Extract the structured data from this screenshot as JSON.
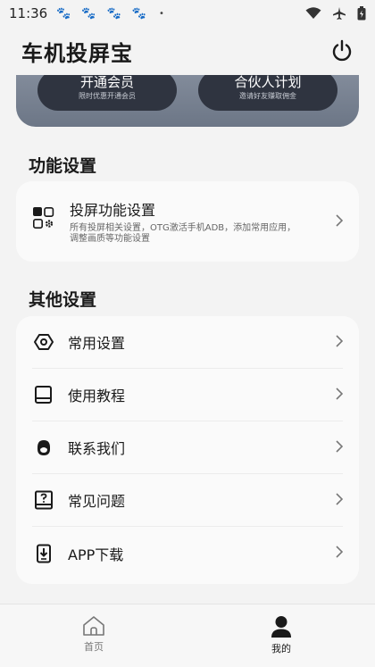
{
  "status_bar": {
    "time": "11:36",
    "notification_icons": [
      "paw-icon",
      "paw-icon",
      "paw-icon",
      "paw-icon"
    ],
    "dot": "•",
    "right_icons": [
      "wifi-icon",
      "airplane-icon",
      "battery-icon"
    ]
  },
  "header": {
    "title": "车机投屏宝"
  },
  "banner": {
    "member": {
      "title": "开通会员",
      "subtitle": "限时优惠开通会员"
    },
    "partner": {
      "title": "合伙人计划",
      "subtitle": "邀请好友赚取佣金"
    }
  },
  "function_settings": {
    "section_title": "功能设置",
    "item": {
      "title": "投屏功能设置",
      "description": "所有投屏相关设置，OTG激活手机ADB，添加常用应用，调整画质等功能设置"
    }
  },
  "other_settings": {
    "section_title": "其他设置",
    "items": [
      {
        "label": "常用设置",
        "icon": "settings-icon"
      },
      {
        "label": "使用教程",
        "icon": "book-icon"
      },
      {
        "label": "联系我们",
        "icon": "contact-icon"
      },
      {
        "label": "常见问题",
        "icon": "faq-icon"
      },
      {
        "label": "APP下载",
        "icon": "download-icon"
      }
    ]
  },
  "tab_bar": {
    "tabs": [
      {
        "label": "首页",
        "icon": "home-icon",
        "active": false
      },
      {
        "label": "我的",
        "icon": "profile-icon",
        "active": true
      }
    ]
  },
  "colors": {
    "background": "#f3f3f3",
    "card": "#fafafa",
    "banner_gradient": [
      "#8b94a3",
      "#6c7686"
    ],
    "pill": "#2f3440",
    "status_paw": "#3a73d8"
  }
}
